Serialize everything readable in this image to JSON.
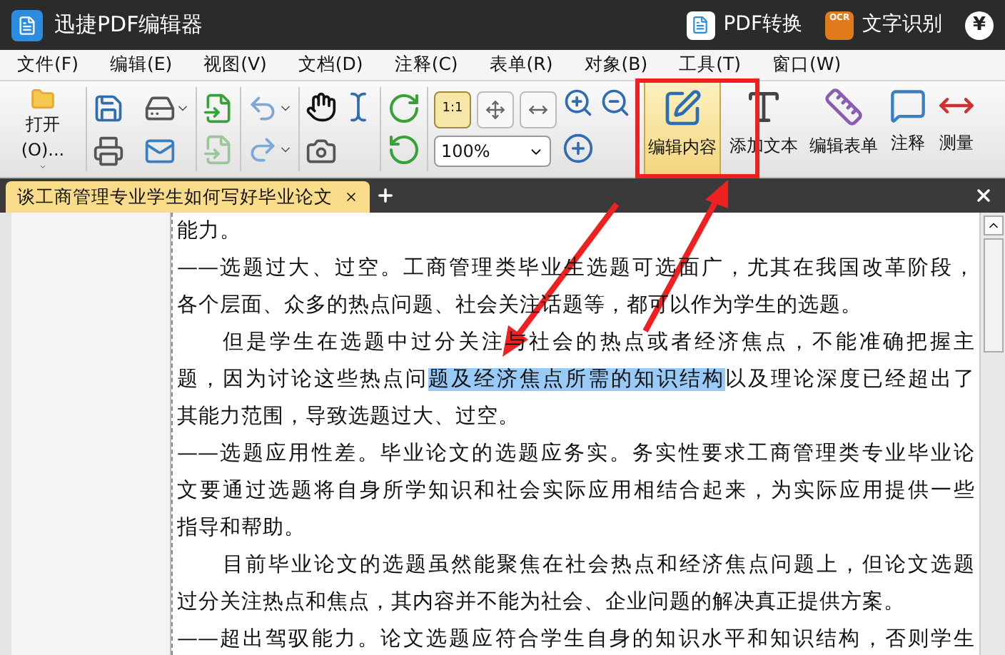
{
  "app": {
    "title": "迅捷PDF编辑器",
    "actions": [
      {
        "label": "PDF转换",
        "kind": "convert"
      },
      {
        "label": "文字识别",
        "kind": "ocr",
        "badge": "OCR"
      }
    ],
    "currency": "¥"
  },
  "menu": [
    "文件(F)",
    "编辑(E)",
    "视图(V)",
    "文档(D)",
    "注释(C)",
    "表单(R)",
    "对象(B)",
    "工具(T)",
    "窗口(W)"
  ],
  "toolbar": {
    "open_label": "打开(O)...",
    "view_buttons": [
      {
        "label": "1:1",
        "selected": true
      },
      {
        "selected": false
      },
      {
        "selected": false
      }
    ],
    "zoom": "100%",
    "large_buttons": [
      {
        "label": "编辑内容",
        "kind": "edit",
        "selected": true
      },
      {
        "label": "添加文本",
        "kind": "text",
        "selected": false
      },
      {
        "label": "编辑表单",
        "kind": "form",
        "selected": false
      },
      {
        "label": "注释",
        "kind": "note",
        "selected": false
      },
      {
        "label": "测量",
        "kind": "measure",
        "selected": false
      }
    ]
  },
  "tabs": [
    {
      "label": "谈工商管理专业学生如何写好毕业论文",
      "selected": true
    }
  ],
  "document": {
    "lines": [
      {
        "kind": "last",
        "parts": [
          {
            "text": "能力。",
            "highlighted": false
          }
        ]
      },
      {
        "kind": "full",
        "parts": [
          {
            "text": "——选题过大、过空。工商管理类毕业生选题可选面广，尤其在我国改革阶段，",
            "highlighted": false
          }
        ]
      },
      {
        "kind": "last",
        "parts": [
          {
            "text": "各个层面、众多的热点问题、社会关注话题等，都可以作为学生的选题。",
            "highlighted": false
          }
        ]
      },
      {
        "kind": "indent",
        "parts": [
          {
            "text": "但是学生在选题中过分关注与社会的热点或者经济焦点，不能准确把握主",
            "highlighted": false
          }
        ]
      },
      {
        "kind": "full",
        "parts": [
          {
            "text": "题，因为讨论这些热点问",
            "highlighted": false
          },
          {
            "text": "题及经济焦点所需的知识结构",
            "highlighted": true
          },
          {
            "text": "以及理论深度已经超出了",
            "highlighted": false
          }
        ]
      },
      {
        "kind": "last",
        "parts": [
          {
            "text": "其能力范围，导致选题过大、过空。",
            "highlighted": false
          }
        ]
      },
      {
        "kind": "full",
        "parts": [
          {
            "text": "——选题应用性差。毕业论文的选题应务实。务实性要求工商管理类专业毕业论",
            "highlighted": false
          }
        ]
      },
      {
        "kind": "full",
        "parts": [
          {
            "text": "文要通过选题将自身所学知识和社会实际应用相结合起来，为实际应用提供一些",
            "highlighted": false
          }
        ]
      },
      {
        "kind": "last",
        "parts": [
          {
            "text": "指导和帮助。",
            "highlighted": false
          }
        ]
      },
      {
        "kind": "indent",
        "parts": [
          {
            "text": "目前毕业论文的选题虽然能聚焦在社会热点和经济焦点问题上，但论文选题",
            "highlighted": false
          }
        ]
      },
      {
        "kind": "last",
        "parts": [
          {
            "text": "过分关注热点和焦点，其内容并不能为社会、企业问题的解决真正提供方案。",
            "highlighted": false
          }
        ]
      },
      {
        "kind": "full",
        "parts": [
          {
            "text": "——超出驾驭能力。论文选题应符合学生自身的知识水平和知识结构，否则学生",
            "highlighted": false
          }
        ]
      }
    ]
  }
}
